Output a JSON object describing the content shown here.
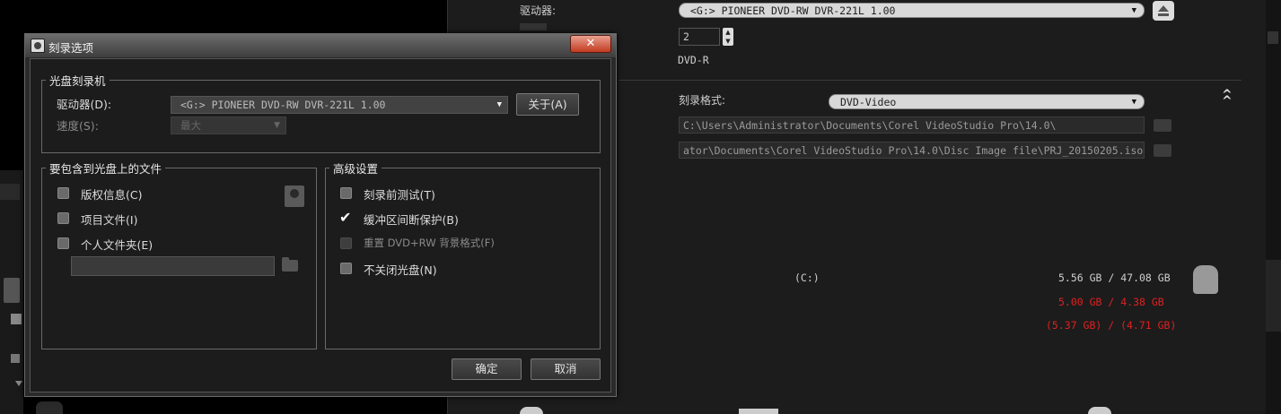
{
  "background": {
    "drive_label": "驱动器:",
    "drive_value": "<G:>  PIONEER DVD-RW  DVR-221L 1.00",
    "copies_value": "2",
    "disc_type": "DVD-R",
    "burn_format_label": "刻录格式:",
    "burn_format_value": "DVD-Video",
    "path1": "C:\\Users\\Administrator\\Documents\\Corel VideoStudio Pro\\14.0\\",
    "path2": "ator\\Documents\\Corel VideoStudio Pro\\14.0\\Disc Image file\\PRJ_20150205.iso",
    "drive_c": "(C:)",
    "space1": "5.56 GB / 47.08 GB",
    "space2": "5.00 GB / 4.38 GB",
    "space3": "(5.37 GB) / (4.71 GB)",
    "colors": {
      "red": "#e02020",
      "panel": "#1c1c1c"
    }
  },
  "dialog": {
    "title": "刻录选项",
    "close": "✕",
    "recorder": {
      "legend": "光盘刻录机",
      "drive_label": "驱动器(D):",
      "drive_value": "<G:>  PIONEER DVD-RW  DVR-221L 1.00",
      "about_button": "关于(A)",
      "speed_label": "速度(S):",
      "speed_value": "最大"
    },
    "files": {
      "legend": "要包含到光盘上的文件",
      "items": [
        {
          "label": "版权信息(C)",
          "checked": false
        },
        {
          "label": "项目文件(I)",
          "checked": false
        },
        {
          "label": "个人文件夹(E)",
          "checked": false
        }
      ]
    },
    "advanced": {
      "legend": "高级设置",
      "items": [
        {
          "label": "刻录前测试(T)",
          "checked": false
        },
        {
          "label": "缓冲区间断保护(B)",
          "checked": true
        },
        {
          "label": "重置 DVD+RW 背景格式(F)",
          "checked": false,
          "disabled": true
        },
        {
          "label": "不关闭光盘(N)",
          "checked": false
        }
      ]
    },
    "ok_button": "确定",
    "cancel_button": "取消"
  }
}
